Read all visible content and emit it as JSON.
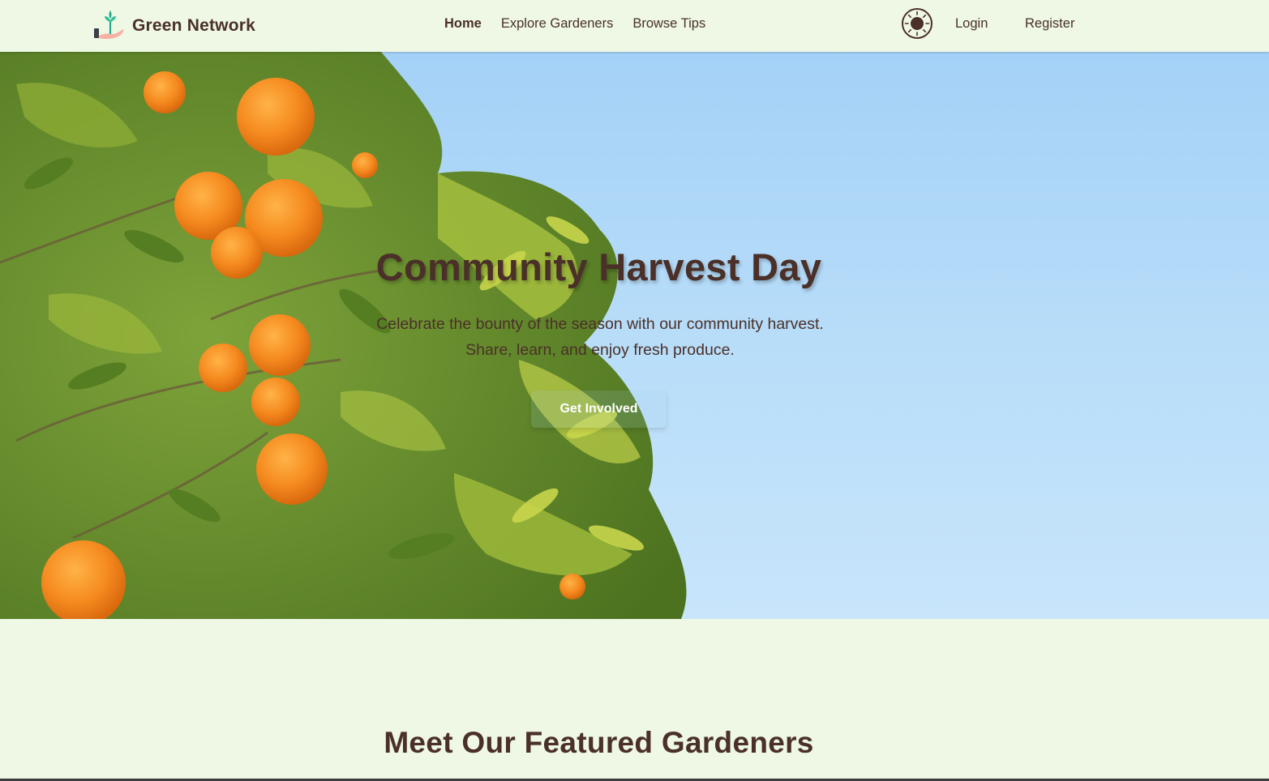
{
  "brand": {
    "name": "Green Network",
    "logo_icon": "sprout-hand-icon"
  },
  "nav": {
    "items": [
      {
        "label": "Home",
        "active": true
      },
      {
        "label": "Explore Gardeners",
        "active": false
      },
      {
        "label": "Browse Tips",
        "active": false
      }
    ],
    "theme_toggle_icon": "sun-icon",
    "login_label": "Login",
    "register_label": "Register"
  },
  "hero": {
    "title": "Community Harvest Day",
    "subtitle_line1": "Celebrate the bounty of the season with our community harvest.",
    "subtitle_line2": "Share, learn, and enjoy fresh produce.",
    "cta_label": "Get Involved"
  },
  "featured": {
    "title": "Meet Our Featured Gardeners"
  },
  "colors": {
    "page_background": "#eef8e5",
    "text_primary": "#4a3028",
    "sky": "#a4d1f7",
    "leaf_green": "#6f9a2c",
    "orange": "#f08a1c"
  }
}
